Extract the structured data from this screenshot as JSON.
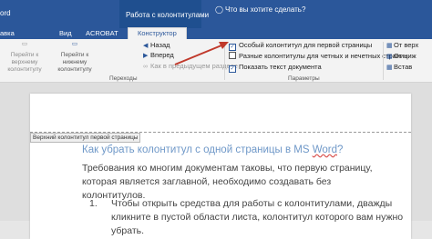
{
  "title_bar": {
    "app": "ord",
    "context_group": "Работа с колонтитулами",
    "tell_me": "Что вы хотите сделать?"
  },
  "tabs": [
    "авка",
    "Вид",
    "ACROBAT",
    "Конструктор"
  ],
  "ribbon": {
    "nav_buttons": {
      "prev_header": "Перейти к верхнему колонтитулу",
      "next_footer": "Перейти к нижнему колонтитулу",
      "back": "Назад",
      "forward": "Вперед",
      "link_to_previous": "Как в предыдущем разделе"
    },
    "nav_group_label": "Переходы",
    "options": [
      {
        "label": "Особый колонтитул для первой страницы",
        "checked": true
      },
      {
        "label": "Разные колонтитулы для четных и нечетных страниц",
        "checked": false
      },
      {
        "label": "Показать текст документа",
        "checked": true
      }
    ],
    "options_group_label": "Параметры",
    "position_items": [
      "От верх",
      "От ниж",
      "Встав"
    ]
  },
  "document": {
    "header_label": "Верхний колонтитул первой страницы",
    "heading_main": "Как убрать колонтитул с одной страницы в MS ",
    "heading_word": "Word",
    "heading_end": "?",
    "paragraph": "Требования ко многим документам таковы, что первую страницу, которая является заглавной, необходимо создавать без колонтитулов.",
    "list_item_number": "1.",
    "list_item_text": "Чтобы открыть средства для работы с колонтитулами, дважды кликните в пустой области листа, колонтитул которого вам нужно убрать."
  },
  "colors": {
    "ribbon_blue": "#2b579a",
    "arrow": "#c0392b",
    "heading": "#6f98c8"
  }
}
